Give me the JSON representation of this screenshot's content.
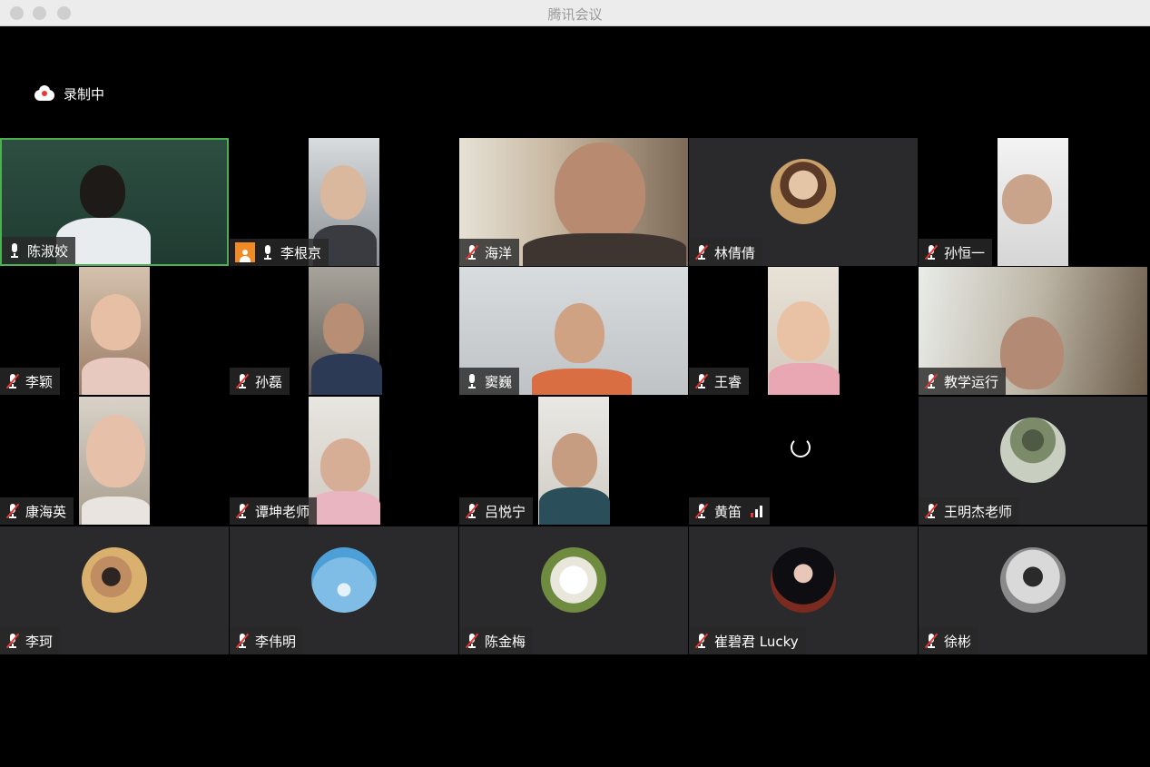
{
  "window": {
    "title": "腾讯会议"
  },
  "recording": {
    "label": "录制中",
    "icon": "cloud-record-icon"
  },
  "participants": [
    {
      "name": "陈淑姣",
      "mic": "on",
      "host": false,
      "active": true
    },
    {
      "name": "李根京",
      "mic": "on",
      "host": true
    },
    {
      "name": "海洋",
      "mic": "muted"
    },
    {
      "name": "林倩倩",
      "mic": "muted"
    },
    {
      "name": "孙恒一",
      "mic": "muted"
    },
    {
      "name": "李颖",
      "mic": "muted"
    },
    {
      "name": "孙磊",
      "mic": "muted"
    },
    {
      "name": "窦巍",
      "mic": "on"
    },
    {
      "name": "王睿",
      "mic": "muted"
    },
    {
      "name": "教学运行",
      "mic": "muted"
    },
    {
      "name": "康海英",
      "mic": "muted"
    },
    {
      "name": "谭坤老师",
      "mic": "muted"
    },
    {
      "name": "吕悦宁",
      "mic": "muted"
    },
    {
      "name": "黄笛",
      "mic": "muted",
      "loading": true,
      "signal": "weak"
    },
    {
      "name": "王明杰老师",
      "mic": "muted"
    },
    {
      "name": "李珂",
      "mic": "muted"
    },
    {
      "name": "李伟明",
      "mic": "muted"
    },
    {
      "name": "陈金梅",
      "mic": "muted"
    },
    {
      "name": "崔碧君 Lucky",
      "mic": "muted"
    },
    {
      "name": "徐彬",
      "mic": "muted"
    }
  ],
  "colors": {
    "active_border": "#4caf50",
    "muted_slash": "#e53935",
    "host_badge": "#f08a24",
    "tile_gray": "#2a2a2c"
  }
}
